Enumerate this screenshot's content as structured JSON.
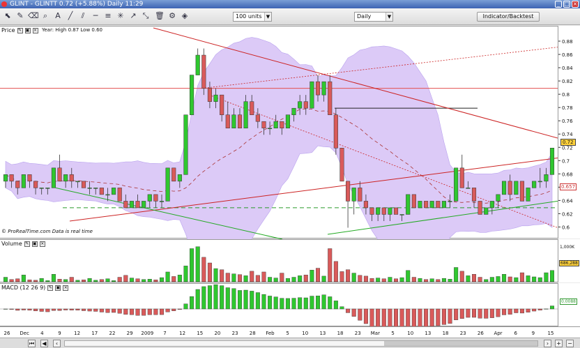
{
  "window": {
    "title": "GLINT - GLINTT   0.72 (+5.88%)   Daily 11:29",
    "controls": [
      "_",
      "□",
      "×"
    ]
  },
  "toolbar": {
    "units": "100 units",
    "period": "Daily",
    "indicator_button": "Indicator/Backtest"
  },
  "price_panel": {
    "label": "Price",
    "info": "Year: High 0.87 Low 0.60",
    "credit": "© ProRealTime.com  Data is real time",
    "current_badge": "0.72",
    "marker_badge": "0.657"
  },
  "volume_panel": {
    "label": "Volume",
    "top_tick": "1,000K",
    "badge": "686,288"
  },
  "macd_panel": {
    "label": "MACD (12 26 9)",
    "badge": "0.0088"
  },
  "colors": {
    "up": "#2fc72f",
    "down": "#d95a5a",
    "band": "#dccaf7",
    "trend": "#cc2222",
    "support": "#22aa22"
  },
  "chart_data": {
    "type": "candlestick",
    "ylim": [
      0.59,
      0.88
    ],
    "y_ticks": [
      "0.88",
      "0.86",
      "0.84",
      "0.82",
      "0.8",
      "0.78",
      "0.76",
      "0.74",
      "0.72",
      "0.7",
      "0.68",
      "0.66",
      "0.64",
      "0.62",
      "0.6"
    ],
    "x_ticks": [
      "26",
      "Dec",
      "4",
      "9",
      "12",
      "17",
      "22",
      "29",
      "2009",
      "7",
      "12",
      "15",
      "20",
      "23",
      "28",
      "Feb",
      "5",
      "10",
      "13",
      "18",
      "23",
      "Mar",
      "5",
      "10",
      "13",
      "18",
      "23",
      "26",
      "Apr",
      "6",
      "9",
      "15"
    ],
    "ohlc": [
      [
        0.67,
        0.68,
        0.66,
        0.68
      ],
      [
        0.68,
        0.68,
        0.66,
        0.67
      ],
      [
        0.67,
        0.67,
        0.65,
        0.66
      ],
      [
        0.66,
        0.68,
        0.66,
        0.68
      ],
      [
        0.68,
        0.68,
        0.66,
        0.67
      ],
      [
        0.67,
        0.67,
        0.65,
        0.66
      ],
      [
        0.66,
        0.66,
        0.65,
        0.66
      ],
      [
        0.66,
        0.66,
        0.65,
        0.66
      ],
      [
        0.66,
        0.69,
        0.66,
        0.69
      ],
      [
        0.69,
        0.71,
        0.67,
        0.67
      ],
      [
        0.67,
        0.68,
        0.66,
        0.68
      ],
      [
        0.68,
        0.69,
        0.66,
        0.67
      ],
      [
        0.67,
        0.67,
        0.66,
        0.67
      ],
      [
        0.67,
        0.67,
        0.66,
        0.66
      ],
      [
        0.66,
        0.67,
        0.65,
        0.66
      ],
      [
        0.66,
        0.66,
        0.65,
        0.66
      ],
      [
        0.66,
        0.66,
        0.65,
        0.65
      ],
      [
        0.65,
        0.66,
        0.64,
        0.65
      ],
      [
        0.65,
        0.66,
        0.65,
        0.66
      ],
      [
        0.66,
        0.66,
        0.64,
        0.64
      ],
      [
        0.64,
        0.65,
        0.63,
        0.63
      ],
      [
        0.63,
        0.64,
        0.63,
        0.64
      ],
      [
        0.64,
        0.65,
        0.63,
        0.63
      ],
      [
        0.63,
        0.64,
        0.63,
        0.64
      ],
      [
        0.64,
        0.65,
        0.63,
        0.65
      ],
      [
        0.65,
        0.65,
        0.63,
        0.64
      ],
      [
        0.64,
        0.65,
        0.63,
        0.64
      ],
      [
        0.64,
        0.69,
        0.64,
        0.69
      ],
      [
        0.69,
        0.69,
        0.67,
        0.67
      ],
      [
        0.67,
        0.68,
        0.66,
        0.68
      ],
      [
        0.68,
        0.77,
        0.68,
        0.77
      ],
      [
        0.77,
        0.83,
        0.77,
        0.83
      ],
      [
        0.83,
        0.87,
        0.83,
        0.86
      ],
      [
        0.86,
        0.87,
        0.8,
        0.81
      ],
      [
        0.81,
        0.82,
        0.78,
        0.79
      ],
      [
        0.79,
        0.81,
        0.78,
        0.8
      ],
      [
        0.8,
        0.8,
        0.76,
        0.77
      ],
      [
        0.77,
        0.79,
        0.75,
        0.75
      ],
      [
        0.75,
        0.78,
        0.75,
        0.77
      ],
      [
        0.77,
        0.78,
        0.75,
        0.75
      ],
      [
        0.75,
        0.8,
        0.75,
        0.79
      ],
      [
        0.79,
        0.8,
        0.77,
        0.77
      ],
      [
        0.77,
        0.78,
        0.75,
        0.76
      ],
      [
        0.76,
        0.76,
        0.74,
        0.75
      ],
      [
        0.75,
        0.76,
        0.74,
        0.75
      ],
      [
        0.75,
        0.77,
        0.75,
        0.76
      ],
      [
        0.76,
        0.76,
        0.74,
        0.75
      ],
      [
        0.75,
        0.77,
        0.75,
        0.77
      ],
      [
        0.77,
        0.78,
        0.76,
        0.78
      ],
      [
        0.78,
        0.8,
        0.77,
        0.79
      ],
      [
        0.79,
        0.8,
        0.77,
        0.78
      ],
      [
        0.78,
        0.82,
        0.78,
        0.82
      ],
      [
        0.82,
        0.83,
        0.79,
        0.8
      ],
      [
        0.8,
        0.82,
        0.79,
        0.82
      ],
      [
        0.82,
        0.83,
        0.77,
        0.77
      ],
      [
        0.77,
        0.78,
        0.71,
        0.72
      ],
      [
        0.72,
        0.72,
        0.67,
        0.67
      ],
      [
        0.67,
        0.67,
        0.6,
        0.64
      ],
      [
        0.64,
        0.66,
        0.62,
        0.66
      ],
      [
        0.66,
        0.67,
        0.64,
        0.64
      ],
      [
        0.64,
        0.65,
        0.62,
        0.63
      ],
      [
        0.63,
        0.63,
        0.61,
        0.62
      ],
      [
        0.62,
        0.63,
        0.61,
        0.63
      ],
      [
        0.63,
        0.63,
        0.61,
        0.62
      ],
      [
        0.62,
        0.63,
        0.61,
        0.63
      ],
      [
        0.63,
        0.63,
        0.62,
        0.62
      ],
      [
        0.62,
        0.62,
        0.61,
        0.62
      ],
      [
        0.62,
        0.65,
        0.62,
        0.65
      ],
      [
        0.65,
        0.65,
        0.63,
        0.63
      ],
      [
        0.63,
        0.64,
        0.63,
        0.64
      ],
      [
        0.64,
        0.64,
        0.63,
        0.63
      ],
      [
        0.63,
        0.64,
        0.63,
        0.64
      ],
      [
        0.64,
        0.64,
        0.63,
        0.63
      ],
      [
        0.63,
        0.64,
        0.63,
        0.64
      ],
      [
        0.64,
        0.65,
        0.63,
        0.64
      ],
      [
        0.64,
        0.69,
        0.64,
        0.69
      ],
      [
        0.69,
        0.71,
        0.66,
        0.66
      ],
      [
        0.66,
        0.67,
        0.66,
        0.66
      ],
      [
        0.66,
        0.66,
        0.63,
        0.64
      ],
      [
        0.64,
        0.64,
        0.62,
        0.62
      ],
      [
        0.62,
        0.63,
        0.62,
        0.63
      ],
      [
        0.63,
        0.64,
        0.62,
        0.64
      ],
      [
        0.64,
        0.65,
        0.63,
        0.65
      ],
      [
        0.65,
        0.67,
        0.65,
        0.67
      ],
      [
        0.67,
        0.68,
        0.64,
        0.65
      ],
      [
        0.65,
        0.67,
        0.65,
        0.67
      ],
      [
        0.67,
        0.67,
        0.64,
        0.64
      ],
      [
        0.64,
        0.66,
        0.64,
        0.66
      ],
      [
        0.66,
        0.67,
        0.66,
        0.67
      ],
      [
        0.67,
        0.69,
        0.66,
        0.67
      ],
      [
        0.67,
        0.69,
        0.66,
        0.68
      ],
      [
        0.68,
        0.72,
        0.68,
        0.72
      ]
    ],
    "volume": [
      120,
      60,
      80,
      180,
      50,
      40,
      90,
      30,
      200,
      70,
      60,
      120,
      40,
      50,
      90,
      40,
      60,
      80,
      30,
      120,
      170,
      100,
      80,
      60,
      70,
      50,
      110,
      260,
      140,
      180,
      420,
      880,
      930,
      650,
      500,
      350,
      320,
      230,
      210,
      190,
      160,
      280,
      170,
      260,
      120,
      100,
      230,
      90,
      120,
      160,
      180,
      310,
      360,
      150,
      880,
      540,
      270,
      320,
      230,
      170,
      150,
      90,
      100,
      80,
      120,
      80,
      110,
      300,
      120,
      90,
      60,
      80,
      60,
      90,
      70,
      380,
      280,
      160,
      200,
      120,
      60,
      120,
      140,
      200,
      130,
      110,
      240,
      160,
      130,
      110,
      240,
      300
    ]
  }
}
